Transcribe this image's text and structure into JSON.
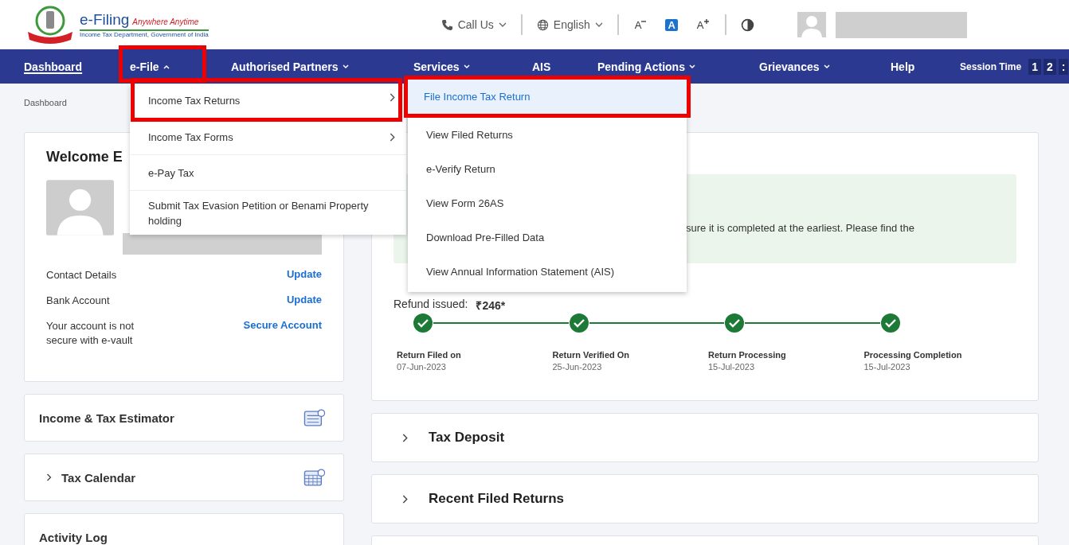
{
  "header": {
    "logo_title": "e-Filing",
    "logo_tagline": "Anywhere Anytime",
    "logo_subtitle": "Income Tax Department, Government of India",
    "call_us": "Call Us",
    "language": "English",
    "font_controls": [
      {
        "label": "A",
        "kind": "decrease",
        "selected": false
      },
      {
        "label": "A",
        "kind": "normal",
        "selected": true
      },
      {
        "label": "A",
        "kind": "increase",
        "selected": false
      }
    ]
  },
  "nav": {
    "items": [
      {
        "label": "Dashboard",
        "kind": "link",
        "selected": true
      },
      {
        "label": "e-File",
        "kind": "open_dropdown",
        "selected": false
      },
      {
        "label": "Authorised Partners",
        "kind": "dropdown",
        "selected": false
      },
      {
        "label": "Services",
        "kind": "dropdown",
        "selected": false
      },
      {
        "label": "AIS",
        "kind": "link",
        "selected": false
      },
      {
        "label": "Pending Actions",
        "kind": "dropdown",
        "selected": false
      },
      {
        "label": "Grievances",
        "kind": "dropdown",
        "selected": false
      },
      {
        "label": "Help",
        "kind": "link",
        "selected": false
      }
    ],
    "session_label": "Session Time",
    "session_digits": [
      "1",
      "2",
      ":"
    ]
  },
  "breadcrumb": "Dashboard",
  "efile_menu": [
    {
      "label": "Income Tax Returns",
      "submenu": true
    },
    {
      "label": "Income Tax Forms",
      "submenu": true
    },
    {
      "label": "e-Pay Tax",
      "submenu": false
    },
    {
      "label": "Submit Tax Evasion Petition or Benami Property holding",
      "submenu": false
    }
  ],
  "returns_submenu": [
    {
      "label": "File Income Tax Return",
      "selected": true
    },
    {
      "label": "View Filed Returns",
      "selected": false
    },
    {
      "label": "e-Verify Return",
      "selected": false
    },
    {
      "label": "View Form 26AS",
      "selected": false
    },
    {
      "label": "Download Pre-Filled Data",
      "selected": false
    },
    {
      "label": "View Annual Information Statement (AIS)",
      "selected": false
    }
  ],
  "annotations": [
    {
      "kind": "nav"
    },
    {
      "kind": "menu"
    },
    {
      "kind": "submenu"
    }
  ],
  "profile_card": {
    "title": "Welcome E",
    "rows": [
      {
        "label": "Contact Details",
        "action": "Update"
      },
      {
        "label": "Bank Account",
        "action": "Update"
      },
      {
        "label": "Your account is not secure with e-vault",
        "action": "Secure Account"
      }
    ]
  },
  "side_cards": [
    {
      "label": "Income & Tax Estimator",
      "kind": "estimator"
    },
    {
      "label": "Tax Calendar",
      "kind": "calendar"
    },
    {
      "label": "Activity Log",
      "kind": "plain"
    }
  ],
  "status_card": {
    "notice": "sure it is completed at the earliest. Please find the",
    "refund_label": "Refund issued:",
    "refund_amount": "₹246*",
    "steps": [
      {
        "label": "Return Filed on",
        "date": "07-Jun-2023",
        "done": true
      },
      {
        "label": "Return Verified On",
        "date": "25-Jun-2023",
        "done": true
      },
      {
        "label": "Return Processing",
        "date": "15-Jul-2023",
        "done": true
      },
      {
        "label": "Processing Completion",
        "date": "15-Jul-2023",
        "done": true
      }
    ]
  },
  "sections": [
    "Tax Deposit",
    "Recent Filed Returns"
  ]
}
